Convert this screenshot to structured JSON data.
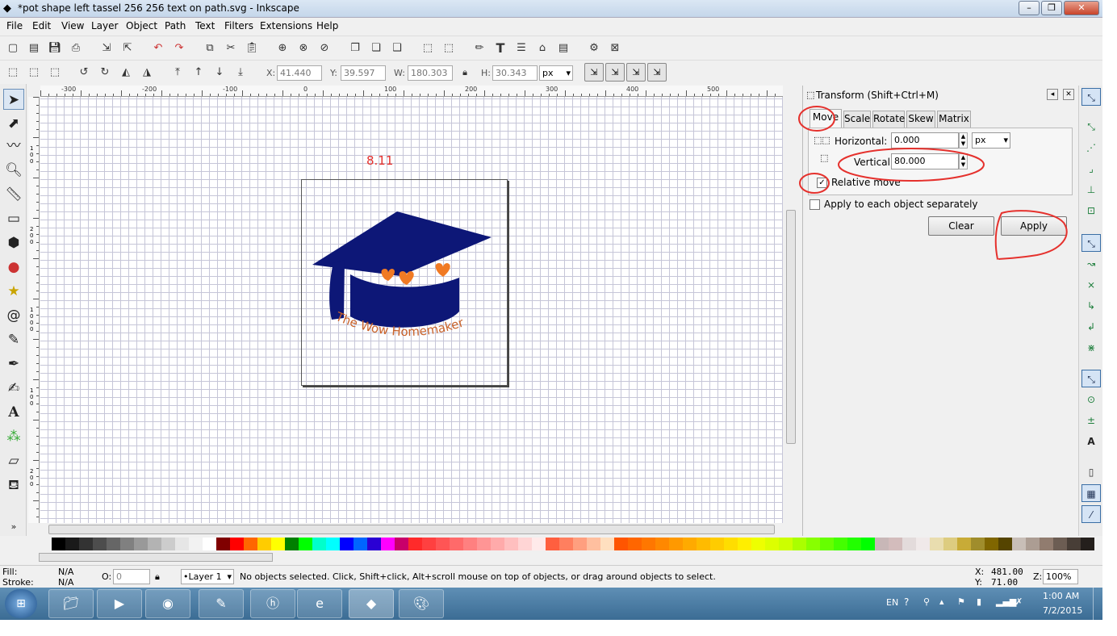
{
  "window": {
    "title": "*pot shape left tassel 256 256 text on path.svg - Inkscape",
    "minimize": "–",
    "restore": "❐",
    "close": "✕"
  },
  "menu": [
    "File",
    "Edit",
    "View",
    "Layer",
    "Object",
    "Path",
    "Text",
    "Filters",
    "Extensions",
    "Help"
  ],
  "icons": {
    "app": "inkscape-logo-icon",
    "cmd": [
      "new-icon",
      "open-icon",
      "save-icon",
      "print-icon",
      "import-icon",
      "export-icon",
      "undo-icon",
      "redo-icon",
      "copy-icon",
      "cut-icon",
      "paste-icon",
      "zoom-selection-icon",
      "zoom-drawing-icon",
      "zoom-page-icon",
      "duplicate-icon",
      "clone-icon",
      "unlink-clone-icon",
      "group-icon",
      "ungroup-icon",
      "fill-stroke-icon",
      "text-font-icon",
      "layers-icon",
      "xml-editor-icon",
      "align-icon",
      "preferences-icon",
      "document-properties-icon"
    ]
  },
  "controls": {
    "x_label": "X:",
    "x_value": "41.440",
    "y_label": "Y:",
    "y_value": "39.597",
    "w_label": "W:",
    "w_value": "180.303",
    "h_label": "H:",
    "h_value": "30.343",
    "unit": "px"
  },
  "ruler": {
    "labels": [
      "-300",
      "-200",
      "-100",
      "0",
      "100",
      "200",
      "300",
      "400",
      "500"
    ],
    "vlabels": [
      "1",
      "0",
      "0",
      "2",
      "0",
      "0",
      "1",
      "0",
      "0",
      "0",
      "1",
      "0",
      "0",
      "2",
      "0",
      "0"
    ]
  },
  "canvas": {
    "annotation_text": "8.11",
    "artwork_text": "The Wow Homemaker",
    "colors": {
      "cap": "#0d1777",
      "hearts": "#f07a24",
      "text": "#c8622a",
      "annotation": "#e5312d"
    }
  },
  "dialog": {
    "title": "Transform (Shift+Ctrl+M)",
    "tabs": [
      "Move",
      "Scale",
      "Rotate",
      "Skew",
      "Matrix"
    ],
    "horizontal_label": "Horizontal:",
    "horizontal_value": "0.000",
    "vertical_label": "Vertical:",
    "vertical_value": "80.000",
    "unit": "px",
    "relative_move_label": "Relative move",
    "relative_move_checked": true,
    "apply_each_label": "Apply to each object separately",
    "apply_each_checked": false,
    "clear_label": "Clear",
    "apply_label": "Apply"
  },
  "palette": [
    "#000000",
    "#1a1a1a",
    "#333333",
    "#4d4d4d",
    "#666666",
    "#808080",
    "#999999",
    "#b3b3b3",
    "#cccccc",
    "#e6e6e6",
    "#f2f2f2",
    "#ffffff",
    "#800000",
    "#ff0000",
    "#ff6600",
    "#ffcc00",
    "#ffff00",
    "#008000",
    "#00ff00",
    "#00ffcc",
    "#00ffff",
    "#0000ff",
    "#0066ff",
    "#2a00d4",
    "#ff00ff",
    "#c8006a",
    "#ff2a2a",
    "#ff4040",
    "#ff5555",
    "#ff6a6a",
    "#ff8080",
    "#ff9595",
    "#ffaaaa",
    "#ffbfbf",
    "#ffd5d5",
    "#ffeaea",
    "#ff5f3f",
    "#ff7f5f",
    "#ff9f7f",
    "#ffbf9f",
    "#ffdfbf",
    "#ff5500",
    "#ff6600",
    "#ff7700",
    "#ff8800",
    "#ff9900",
    "#ffaa00",
    "#ffbb00",
    "#ffcc00",
    "#ffdd00",
    "#ffee00",
    "#eeff00",
    "#ddff00",
    "#ccff00",
    "#aaff00",
    "#88ff00",
    "#66ff00",
    "#44ff00",
    "#22ff00",
    "#00ff00",
    "#c8b7b7",
    "#d3bcbc",
    "#e3dbdb",
    "#f0e9e9",
    "#e9ddaf",
    "#ddcc80",
    "#c8ab37",
    "#a08d2c",
    "#806600",
    "#554400",
    "#c8beb7",
    "#ac9d93",
    "#917c6f",
    "#6c5d53",
    "#483e37",
    "#241f1c"
  ],
  "status": {
    "fill_label": "Fill:",
    "fill_value": "N/A",
    "stroke_label": "Stroke:",
    "stroke_value": "N/A",
    "opacity_label": "O:",
    "opacity_value": "0",
    "layer": "•Layer 1",
    "message": "No objects selected. Click, Shift+click, Alt+scroll mouse on top of objects, or drag around objects to select.",
    "x_label": "X:",
    "x_value": "481.00",
    "y_label": "Y:",
    "y_value": "71.00",
    "zoom_label": "Z:",
    "zoom_value": "100%"
  },
  "taskbar": {
    "lang": "EN",
    "time": "1:00 AM",
    "date": "7/2/2015"
  }
}
